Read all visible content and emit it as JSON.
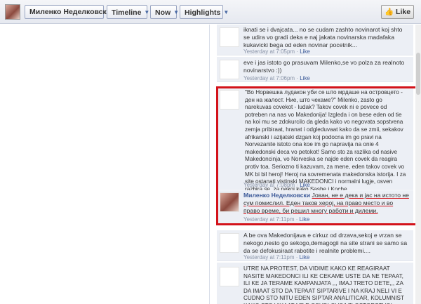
{
  "header": {
    "profile_name": "Миленко Неделковски",
    "tabs": [
      {
        "label": "Timeline"
      },
      {
        "label": "Now"
      },
      {
        "label": "Highlights"
      }
    ],
    "like_label": "Like"
  },
  "comments": [
    {
      "text": "iknati se i dvajcata... no se cudam zashto novinarot koj shto se udira vo gradi deka e naj jakata novinarska madafaka kukavicki bega od eden novinar pocetnik...",
      "time": "Yesterday at 7:05pm",
      "like": "Like"
    },
    {
      "text": "eve i jas istoto go prasuvam Milenko,se vo polza za realnoto novinarstvo :))",
      "time": "Yesterday at 7:06pm",
      "like": "Like"
    },
    {
      "text": "\"Во Норвешка лудакон уби се што мрдаше на островцето - ден на жалост. Ние, што чекаме?\" Milenko, zasto go narekuvas covekot - ludak? Takov covek ni e povece od potreben na nas vo Makedonija! Izgleda i on bese eden od tie na koi mu se zdokurcilo da gleda kako vo negovata sopstvena zemja pribiraat, hranat i odgleduvaat kako da se zmii, sekakov afrikanski i azijatski dzgan koj podocna im go pravi na Norvezanite istoto ona koe im go napravija na onie 4 makedonski deca vo petokot! Samo sto za razlika od nasive Makedoncinja, vo Norveska se najde eden covek da reagira protiv toa. Seriozno ti kazuvam, za mene, eden takov covek vo MK bi bil heroj! Heroj na sovremenata makedonska istorija. I za site ostanati vistinski MAKEDONCI i normalni lugje, osven razbira se, za nekoi kako Sashe i Koche....",
      "time": "Yesterday at 7:08pm",
      "like": "Like"
    },
    {
      "author": "Миленко Неделковски",
      "text": "Јован, не е дека и јас на истото не сум помислил. Еден таков херој, на право место и во право време, би решил многу работи и дилеми.",
      "time": "Yesterday at 7:11pm",
      "like": "Like"
    },
    {
      "text": "A be ova Makedonijava e cirkuz od drzava,sekoj e vrzan se nekogo,nesto go sekogo,demagogii na site strani se samo sa da se defokusiraat rabotite i realnite problemi....",
      "time": "Yesterday at 7:11pm",
      "like": "Like"
    },
    {
      "text": "UTRE NA PROTEST, DA VIDIME KAKO KE REAGIRAAT NASITE MAKEDONCI ILI KE CEKAME USTE DA NE TEPAAT, ILI KE JA TERAME KAMPANJATA ,,, IMAJ TRETO DETE,,, ZA DA IMAAT STO DA TEPAAT SIPTARIVE I NA KRAJ NELI VI E CUDNO STO NITU EDEN SIPTAR ANALITICAR, KOLUMNIST KAKO STO VIKAAT NE E OSUDI OVOJ ZLOSTORSTVO!"
    }
  ]
}
